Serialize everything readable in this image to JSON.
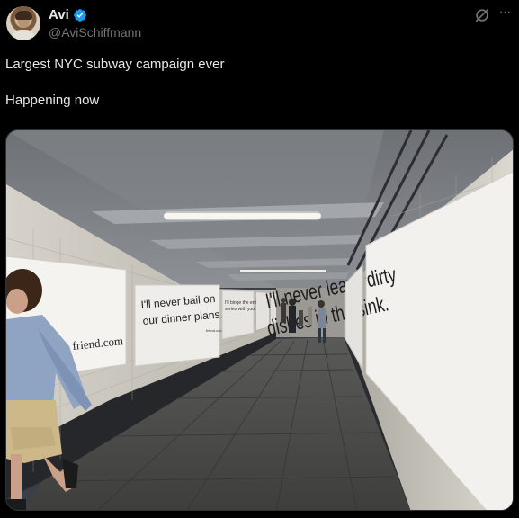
{
  "author": {
    "display_name": "Avi",
    "handle": "@AviSchiffmann",
    "verified": true,
    "verified_color": "#1d9bf0"
  },
  "icons": {
    "grok": "grok-icon",
    "more": "more-icon",
    "verified": "verified-badge-icon"
  },
  "tweet": {
    "line1": "Largest NYC subway campaign ever",
    "line2": "Happening now"
  },
  "media": {
    "ads": {
      "left_big_brand": "friend.com",
      "left_mid_line1": "I'll never bail on",
      "left_mid_line2": "our dinner plans.",
      "left_mid_brand": "friend.com",
      "left_small_line1": "I'll binge the entire",
      "left_small_line2": "series with you.",
      "right_line1": "I'll never leave dirty",
      "right_line2": "dishes in the sink."
    }
  },
  "colors": {
    "background": "#000000",
    "text_primary": "#e7e9ea",
    "text_secondary": "#71767b"
  }
}
